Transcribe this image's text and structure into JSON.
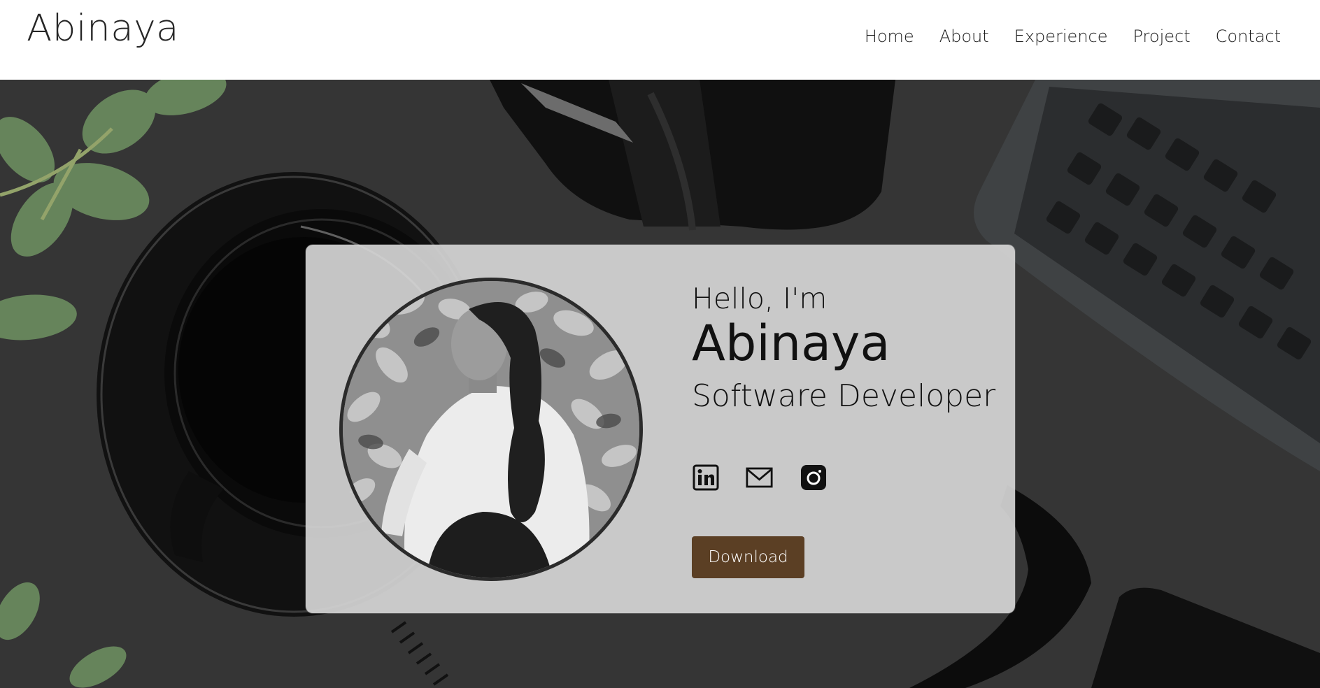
{
  "header": {
    "brand": "Abinaya",
    "nav": [
      {
        "label": "Home"
      },
      {
        "label": "About"
      },
      {
        "label": "Experience"
      },
      {
        "label": "Project"
      },
      {
        "label": "Contact"
      }
    ]
  },
  "hero": {
    "greeting": "Hello, I'm",
    "name": "Abinaya",
    "role": "Software Developer",
    "socials": [
      {
        "icon": "linkedin-icon"
      },
      {
        "icon": "mail-icon"
      },
      {
        "icon": "instagram-icon"
      }
    ],
    "download_label": "Download"
  },
  "colors": {
    "download_button": "#5b3f24",
    "card_background": "#d6d6d6",
    "header_background": "#ffffff"
  }
}
